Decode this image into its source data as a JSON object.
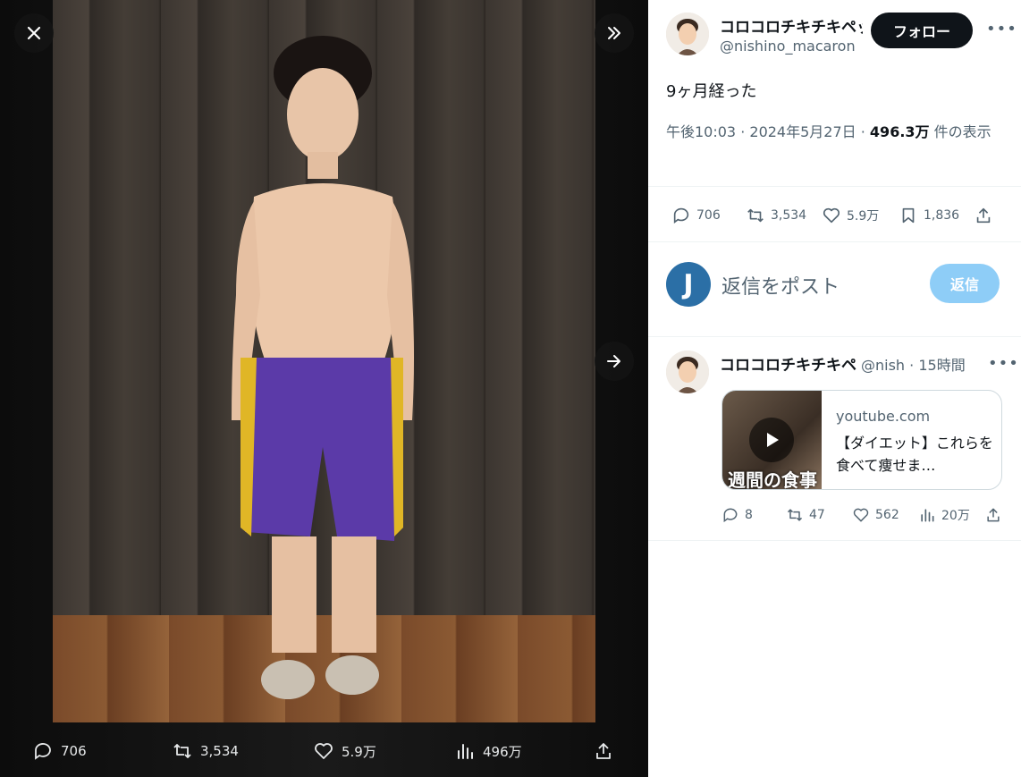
{
  "viewer": {
    "close_label": "close",
    "actions": {
      "replies": "706",
      "reposts": "3,534",
      "likes": "5.9万",
      "views": "496万"
    }
  },
  "post": {
    "display_name": "コロコロチキチキペッパーズ",
    "handle": "@nishino_macaron",
    "follow_label": "フォロー",
    "text": "9ヶ月経った",
    "time": "午後10:03",
    "date": "2024年5月27日",
    "views_count": "496.3万",
    "views_suffix": "件の表示",
    "stats": {
      "replies": "706",
      "reposts": "3,534",
      "likes": "5.9万",
      "bookmarks": "1,836"
    }
  },
  "reply_box": {
    "avatar_letter": "J",
    "placeholder": "返信をポスト",
    "button_label": "返信"
  },
  "reply": {
    "display_name": "コロコロチキチキペッパーズ",
    "handle": "@nish",
    "time": "15時間",
    "card": {
      "thumb_text": "週間の食事",
      "domain": "youtube.com",
      "title": "【ダイエット】これらを食べて痩せま…"
    },
    "stats": {
      "replies": "8",
      "reposts": "47",
      "likes": "562",
      "views": "20万"
    }
  },
  "colors": {
    "follow_bg": "#0f1419",
    "reply_button_bg": "#8ecdf7",
    "secondary_text": "#536471"
  }
}
